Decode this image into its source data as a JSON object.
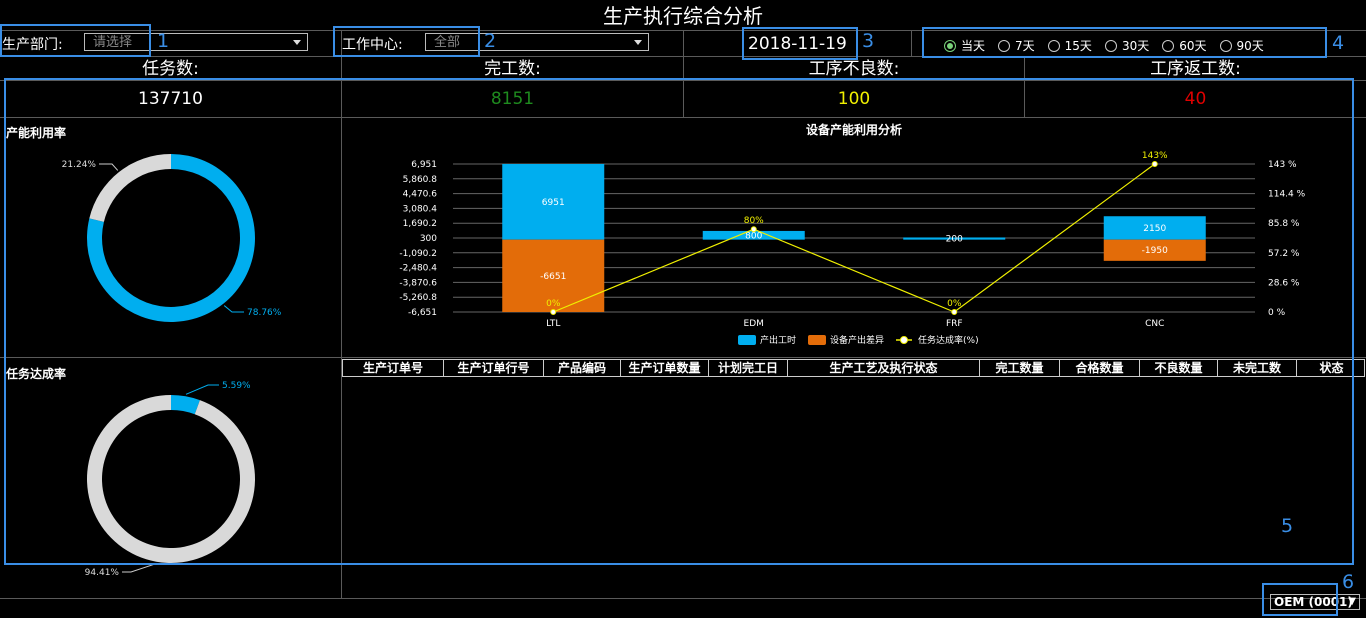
{
  "title": "生产执行综合分析",
  "filters": {
    "dept_label": "生产部门:",
    "dept_placeholder": "请选择",
    "workcenter_label": "工作中心:",
    "workcenter_value": "全部",
    "date": "2018-11-19",
    "periods": [
      "当天",
      "7天",
      "15天",
      "30天",
      "60天",
      "90天"
    ],
    "selected_period": "当天"
  },
  "stats": [
    {
      "label": "任务数:",
      "value": "137710",
      "color": "#ffffff"
    },
    {
      "label": "完工数:",
      "value": "8151",
      "color": "#1e8a1e"
    },
    {
      "label": "工序不良数:",
      "value": "100",
      "color": "#f0f000"
    },
    {
      "label": "工序返工数:",
      "value": "40",
      "color": "#e00000"
    }
  ],
  "capacity_util": {
    "title": "产能利用率",
    "slices": [
      {
        "label": "78.76%",
        "value": 78.76,
        "color": "#00aeef"
      },
      {
        "label": "21.24%",
        "value": 21.24,
        "color": "#d9d9d9"
      }
    ]
  },
  "task_completion": {
    "title": "任务达成率",
    "slices": [
      {
        "label": "5.59%",
        "value": 5.59,
        "color": "#00aeef"
      },
      {
        "label": "94.41%",
        "value": 94.41,
        "color": "#d9d9d9"
      }
    ]
  },
  "chart_data": {
    "type": "bar",
    "title": "设备产能利用分析",
    "categories": [
      "LTL",
      "EDM",
      "FRF",
      "CNC"
    ],
    "series": [
      {
        "name": "产出工时",
        "type": "bar",
        "values": [
          6951,
          800,
          200,
          2150
        ],
        "color": "#00aeef"
      },
      {
        "name": "设备产出差异",
        "type": "bar",
        "values": [
          -6651,
          0,
          0,
          -1950
        ],
        "color": "#e36c09"
      },
      {
        "name": "任务达成率(%)",
        "type": "line",
        "axis": "right",
        "values": [
          0,
          80,
          0,
          143
        ],
        "labels": [
          "0%",
          "80%",
          "0%",
          "143%"
        ],
        "color": "#f0f000"
      }
    ],
    "left_ticks": [
      "6,951",
      "5,860.8",
      "4,470.6",
      "3,080.4",
      "1,690.2",
      "300",
      "-1,090.2",
      "-2,480.4",
      "-3,870.6",
      "-5,260.8",
      "-6,651"
    ],
    "ylim": [
      -6651,
      6951
    ],
    "right_ticks": [
      "143 %",
      "114.4 %",
      "85.8 %",
      "57.2 %",
      "28.6 %",
      "0 %"
    ],
    "y2lim": [
      0,
      143
    ],
    "legend": "bottom"
  },
  "table": {
    "columns": [
      "生产订单号",
      "生产订单行号",
      "产品编码",
      "生产订单数量",
      "计划完工日",
      "生产工艺及执行状态",
      "完工数量",
      "合格数量",
      "不良数量",
      "未完工数",
      "状态"
    ]
  },
  "org_select": "OEM (0001)",
  "annotations": [
    "1",
    "2",
    "3",
    "4",
    "5",
    "6"
  ]
}
